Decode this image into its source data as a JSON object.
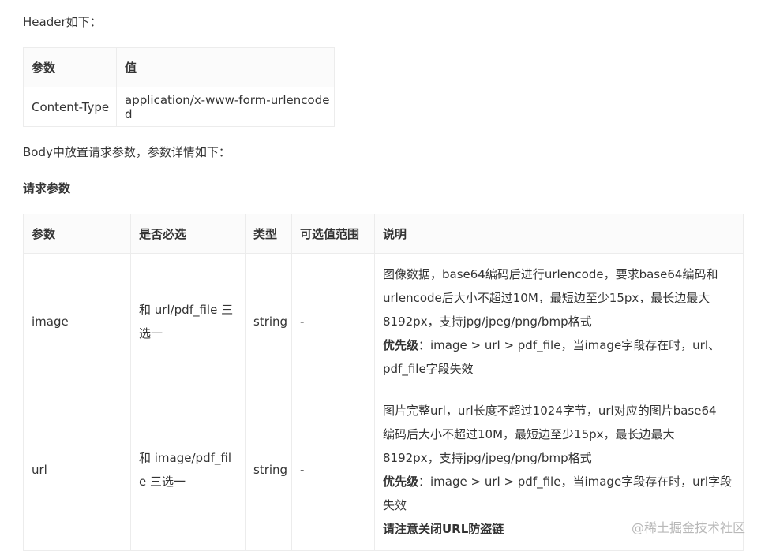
{
  "header_intro": "Header如下：",
  "header_table": {
    "columns": [
      "参数",
      "值"
    ],
    "rows": [
      [
        "Content-Type",
        "application/x-www-form-urlencoded"
      ]
    ]
  },
  "body_intro": "Body中放置请求参数，参数详情如下：",
  "request_params_title": "请求参数",
  "params_table": {
    "columns": [
      "参数",
      "是否必选",
      "类型",
      "可选值范围",
      "说明"
    ],
    "rows": [
      {
        "name": "image",
        "required": "和 url/pdf_file 三选一",
        "type": "string",
        "range": "-",
        "desc_lines": [
          "图像数据，base64编码后进行urlencode，要求base64编码和",
          "urlencode后大小不超过10M，最短边至少15px，最长边最大",
          "8192px，支持jpg/jpeg/png/bmp格式"
        ],
        "priority_label": "优先级",
        "priority_lines": [
          "：image > url > pdf_file，当image字段存在时，url、",
          "pdf_file字段失效"
        ]
      },
      {
        "name": "url",
        "required": "和 image/pdf_file 三选一",
        "type": "string",
        "range": "-",
        "desc_lines": [
          "图片完整url，url长度不超过1024字节，url对应的图片base64",
          "编码后大小不超过10M，最短边至少15px，最长边最大",
          "8192px，支持jpg/jpeg/png/bmp格式"
        ],
        "priority_label": "优先级",
        "priority_lines": [
          "：image > url > pdf_file，当image字段存在时，url字段",
          "失效"
        ],
        "note": "请注意关闭URL防盗链"
      }
    ]
  },
  "watermark": "@稀土掘金技术社区"
}
